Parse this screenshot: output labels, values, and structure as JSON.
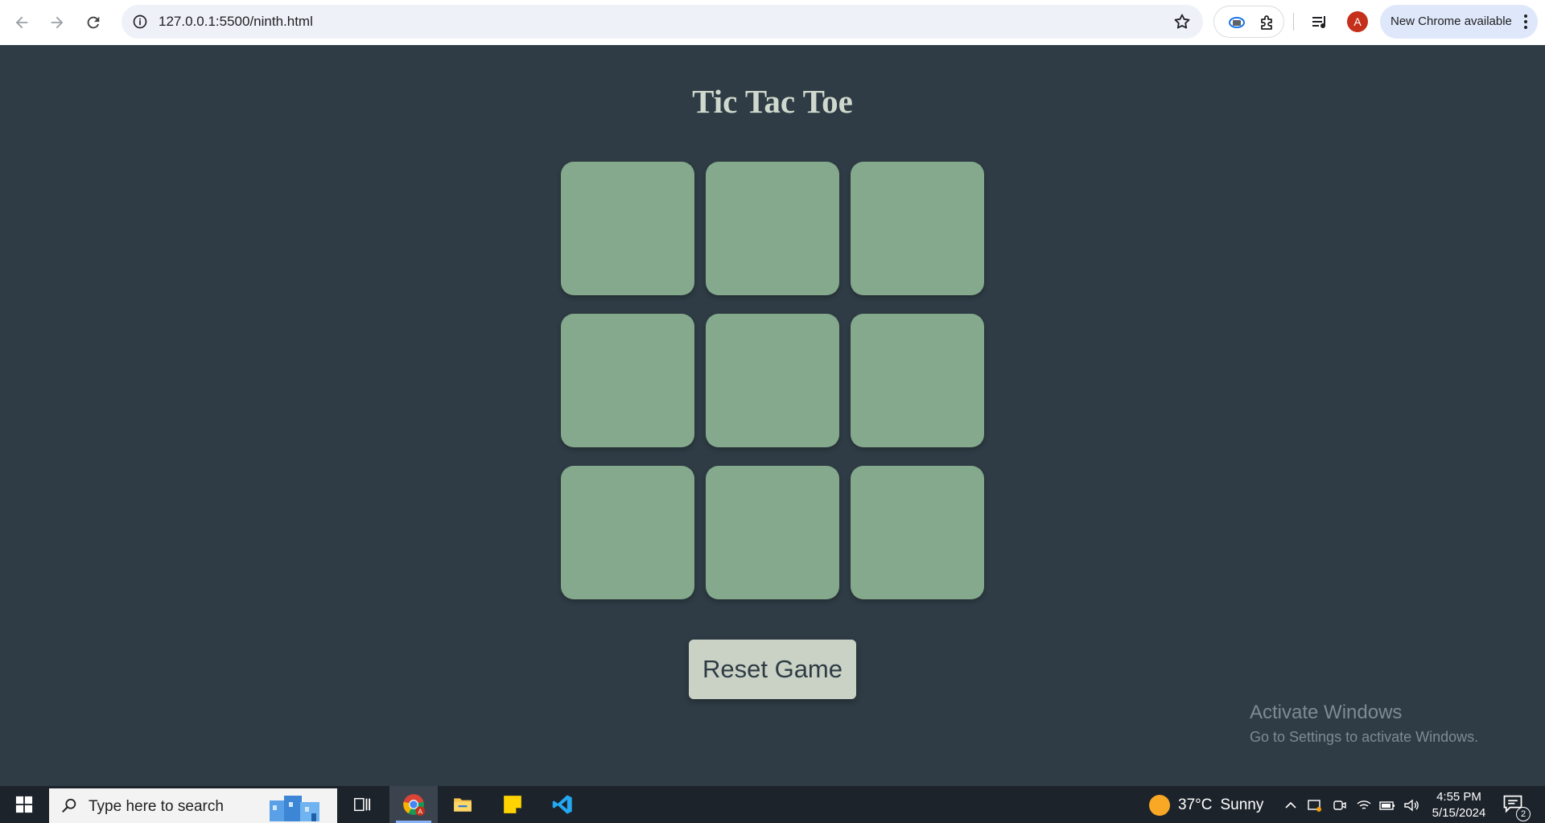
{
  "browser": {
    "url": "127.0.0.1:5500/ninth.html",
    "profile_initial": "A",
    "update_label": "New Chrome available"
  },
  "page": {
    "title": "Tic Tac Toe",
    "cells": [
      "",
      "",
      "",
      "",
      "",
      "",
      "",
      "",
      ""
    ],
    "reset_label": "Reset Game"
  },
  "watermark": {
    "title": "Activate Windows",
    "subtitle": "Go to Settings to activate Windows."
  },
  "taskbar": {
    "search_placeholder": "Type here to search",
    "weather_temp": "37°C",
    "weather_desc": "Sunny",
    "time": "4:55 PM",
    "date": "5/15/2024",
    "notification_count": "2"
  },
  "colors": {
    "page_bg": "#2f3c45",
    "title": "#cfd8cc",
    "cell": "#84a98c",
    "button_bg": "#cad2c5",
    "button_text": "#2f3c45"
  },
  "icons": [
    "back-icon",
    "forward-icon",
    "reload-icon",
    "info-icon",
    "star-icon",
    "extension-icon",
    "puzzle-icon",
    "media-icon",
    "kebab-icon",
    "windows-icon",
    "search-icon",
    "task-view-icon",
    "chrome-icon",
    "file-explorer-icon",
    "sticky-notes-icon",
    "vscode-icon",
    "sun-icon",
    "chevron-up-icon",
    "network-icon",
    "battery-icon",
    "volume-icon",
    "notification-icon"
  ]
}
